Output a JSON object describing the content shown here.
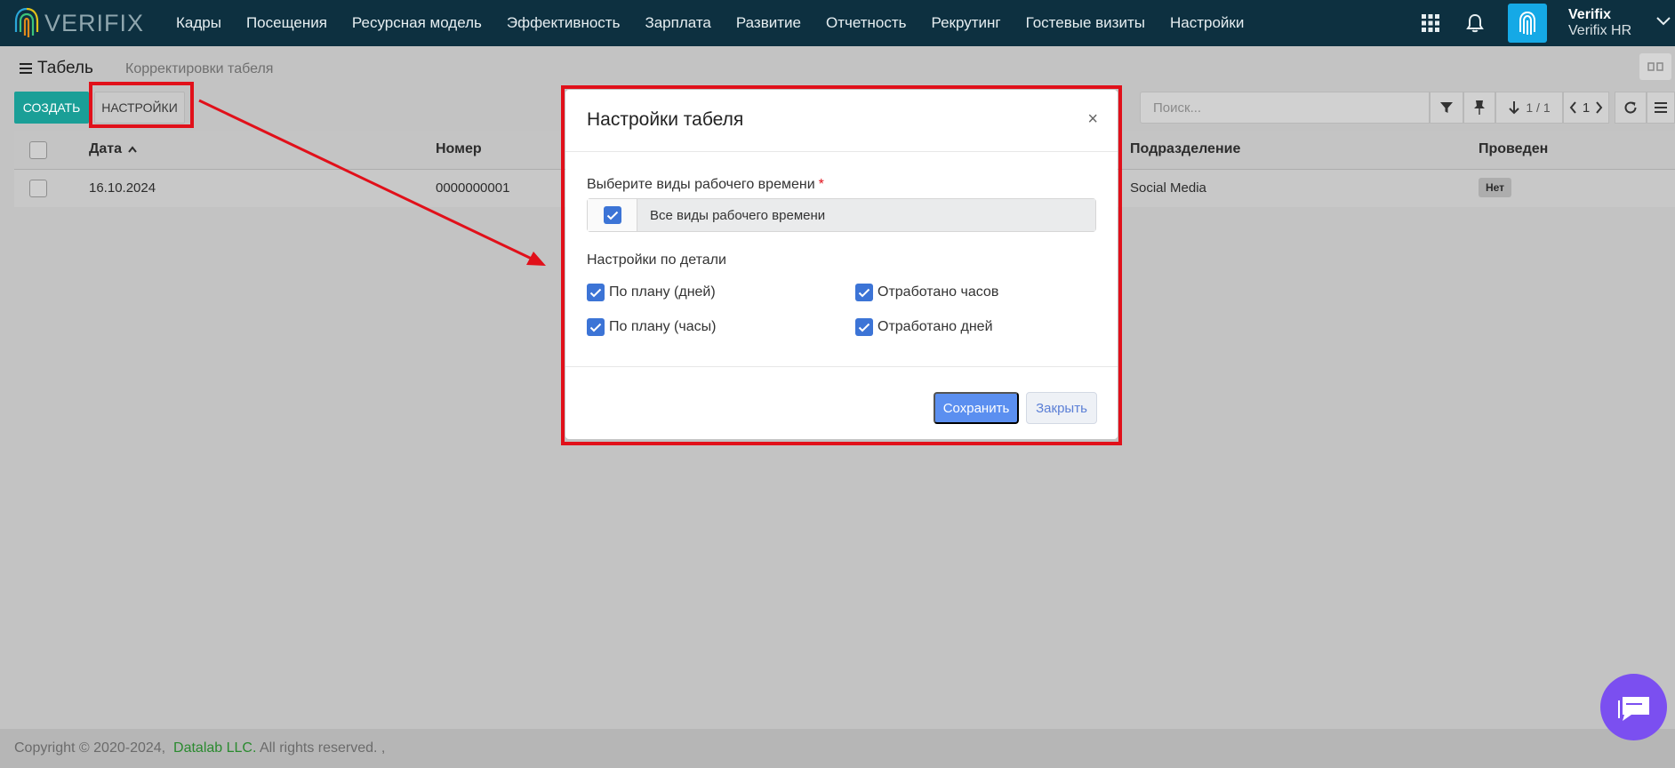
{
  "navbar": {
    "logo_text": "VERIFIX",
    "menu": [
      "Кадры",
      "Посещения",
      "Ресурсная модель",
      "Эффективность",
      "Зарплата",
      "Развитие",
      "Отчетность",
      "Рекрутинг",
      "Гостевые визиты",
      "Настройки"
    ],
    "user_name": "Verifix",
    "user_org": "Verifix HR",
    "icons": [
      "apps-grid-icon",
      "bell-icon",
      "fingerprint-icon",
      "chevron-down-icon"
    ]
  },
  "page": {
    "title": "Табель",
    "tab_link": "Корректировки табеля",
    "create_label": "СОЗДАТЬ",
    "settings_label": "НАСТРОЙКИ"
  },
  "toolbar": {
    "search_placeholder": "Поиск...",
    "pagination": "1 / 1",
    "page_number": "1"
  },
  "table": {
    "columns": [
      "Дата",
      "Номер",
      "Подразделение",
      "Проведен"
    ],
    "rows": [
      {
        "date": "16.10.2024",
        "number": "0000000001",
        "department": "Social Media",
        "posted": "Нет"
      }
    ]
  },
  "footer": {
    "copyright": "Copyright © 2020-2024,",
    "company": "Datalab LLC.",
    "rights": "All rights reserved. ,"
  },
  "modal": {
    "title": "Настройки табеля",
    "close_symbol": "×",
    "field_label": "Выберите виды рабочего времени",
    "required_mark": "*",
    "field_value": "Все виды рабочего времени",
    "section_label": "Настройки по детали",
    "options": [
      "По плану (дней)",
      "Отработано часов",
      "По плану (часы)",
      "Отработано дней"
    ],
    "save_label": "Сохранить",
    "close_label": "Закрыть"
  },
  "colors": {
    "navbar": "#0d3040",
    "accent": "#1a9f97",
    "checkbox": "#3c74d6",
    "highlight": "#e1101a",
    "chat": "#7b4ff0"
  }
}
